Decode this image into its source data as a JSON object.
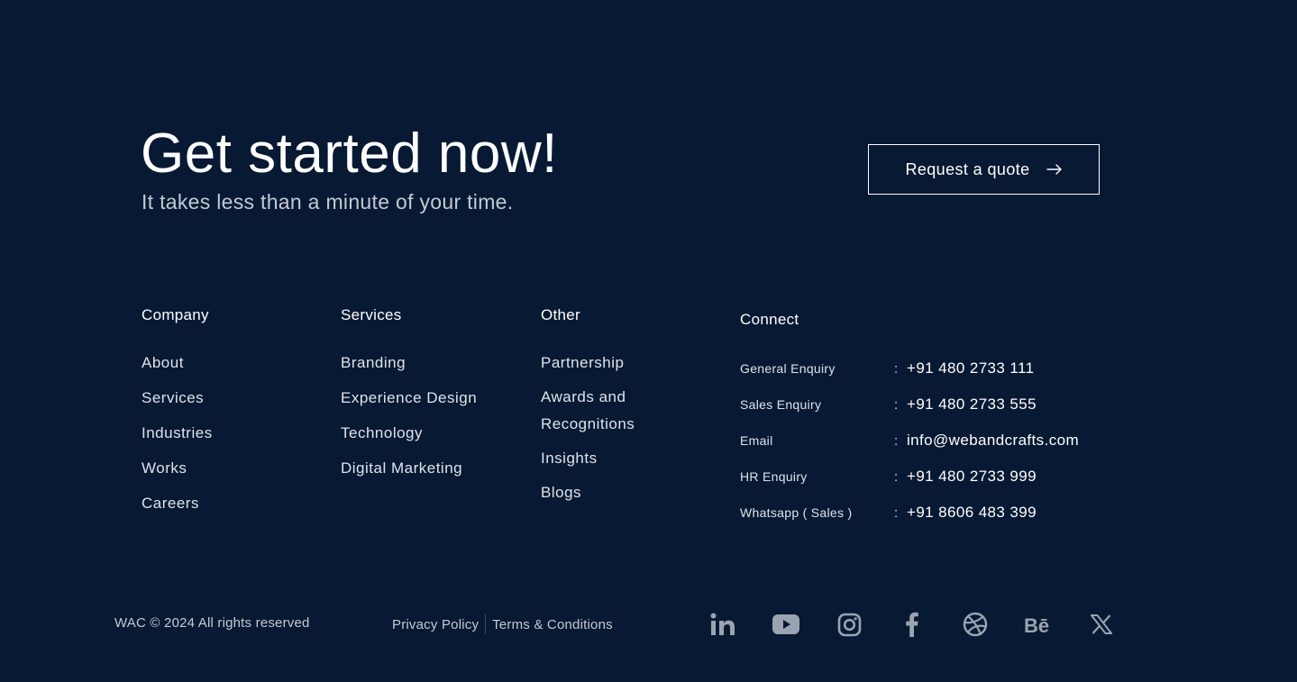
{
  "hero": {
    "title": "Get started now!",
    "subtitle": "It takes less than a minute of your time.",
    "cta_label": "Request a quote",
    "cta_icon": "arrow-right-icon"
  },
  "footer": {
    "company": {
      "heading": "Company",
      "links": [
        "About",
        "Services",
        "Industries",
        "Works",
        "Careers"
      ]
    },
    "services": {
      "heading": "Services",
      "links": [
        "Branding",
        "Experience Design",
        "Technology",
        "Digital Marketing"
      ]
    },
    "other": {
      "heading": "Other",
      "links": [
        "Partnership",
        "Awards and Recognitions",
        "Insights",
        "Blogs"
      ]
    },
    "connect": {
      "heading": "Connect",
      "separator": ":",
      "rows": [
        {
          "label": "General Enquiry",
          "value": "+91 480 2733 111"
        },
        {
          "label": "Sales Enquiry",
          "value": "+91 480 2733 555"
        },
        {
          "label": "Email",
          "value": "info@webandcrafts.com"
        },
        {
          "label": "HR Enquiry",
          "value": "+91 480 2733 999"
        },
        {
          "label": "Whatsapp ( Sales )",
          "value": "+91 8606 483 399"
        }
      ]
    }
  },
  "bottom": {
    "copyright": "WAC © 2024 All rights reserved",
    "privacy": "Privacy Policy",
    "terms": "Terms & Conditions",
    "social_icons": [
      "linkedin-icon",
      "youtube-icon",
      "instagram-icon",
      "facebook-icon",
      "dribbble-icon",
      "behance-icon",
      "x-icon"
    ]
  },
  "colors": {
    "background": "#071933",
    "text": "#ffffff",
    "muted_text": "#c4cad4",
    "icon": "#9aa3b0"
  }
}
